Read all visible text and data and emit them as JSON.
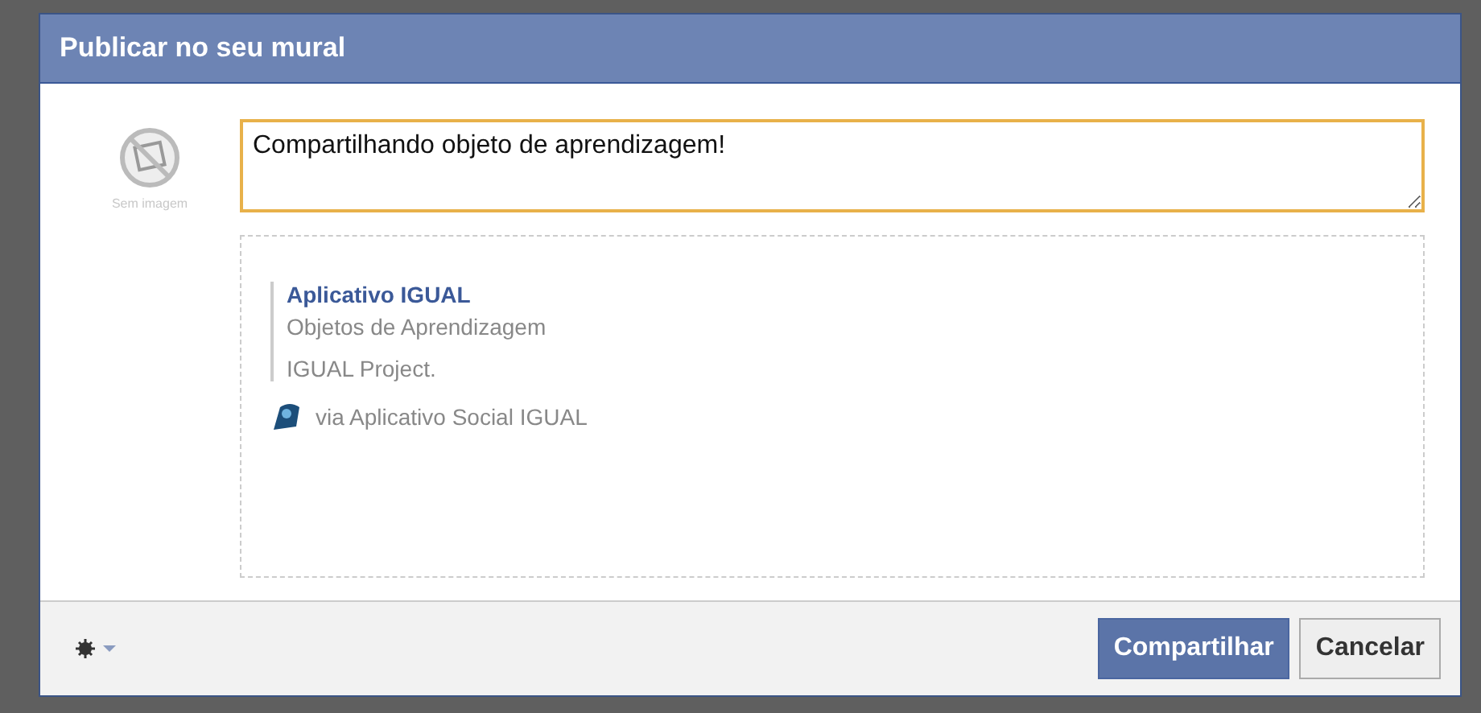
{
  "dialog": {
    "title": "Publicar no seu mural"
  },
  "avatar": {
    "caption": "Sem imagem"
  },
  "message": {
    "value": "Compartilhando objeto de aprendizagem!"
  },
  "attachment": {
    "title": "Aplicativo IGUAL",
    "subtitle": "Objetos de Aprendizagem",
    "description": "IGUAL Project.",
    "via": "via Aplicativo Social IGUAL"
  },
  "footer": {
    "buttons": [
      {
        "label": "Compartilhar",
        "kind": "primary"
      },
      {
        "label": "Cancelar",
        "kind": "secondary"
      }
    ]
  }
}
